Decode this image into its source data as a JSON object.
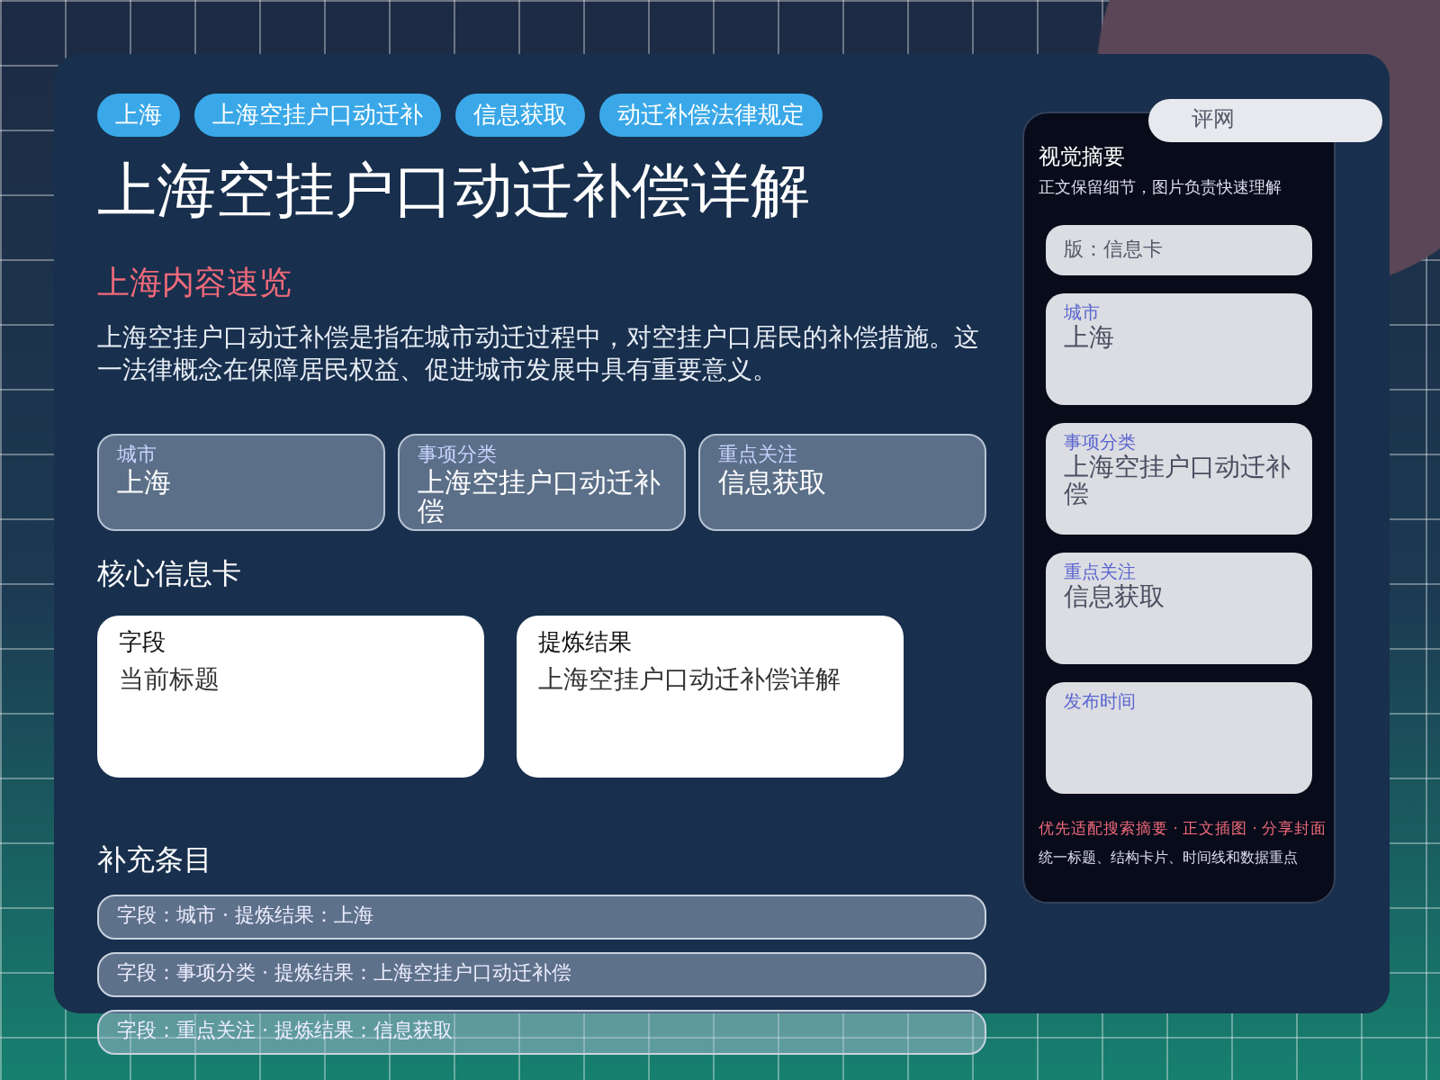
{
  "tags": [
    {
      "label": "上海"
    },
    {
      "label": "上海空挂户口动迁补"
    },
    {
      "label": "信息获取"
    },
    {
      "label": "动迁补偿法律规定"
    }
  ],
  "title": "上海空挂户口动迁补偿详解",
  "subtitle": "上海内容速览",
  "intro": "上海空挂户口动迁补偿是指在城市动迁过程中，对空挂户口居民的补偿措施。这一法律概念在保障居民权益、促进城市发展中具有重要意义。",
  "stats": [
    {
      "label": "城市",
      "value": "上海"
    },
    {
      "label": "事项分类",
      "value": "上海空挂户口动迁补偿"
    },
    {
      "label": "重点关注",
      "value": "信息获取"
    }
  ],
  "core_section": {
    "heading": "核心信息卡",
    "cards": [
      {
        "label": "字段",
        "value": "当前标题"
      },
      {
        "label": "提炼结果",
        "value": "上海空挂户口动迁补偿详解"
      }
    ]
  },
  "extra_section": {
    "heading": "补充条目",
    "rows": [
      "字段：城市 · 提炼结果：上海",
      "字段：事项分类 · 提炼结果：上海空挂户口动迁补偿",
      "字段：重点关注 · 提炼结果：信息获取"
    ]
  },
  "corner_pill": "评网",
  "sidebar": {
    "title": "视觉摘要",
    "subtitle": "正文保留细节，图片负责快速理解",
    "top_pill": "版：信息卡",
    "cards": [
      {
        "label": "城市",
        "value": "上海"
      },
      {
        "label": "事项分类",
        "value": "上海空挂户口动迁补偿"
      },
      {
        "label": "重点关注",
        "value": "信息获取"
      },
      {
        "label": "发布时间"
      }
    ],
    "note": "优先适配搜索摘要 · 正文插图 · 分享封面",
    "footer": "统一标题、结构卡片、时间线和数据重点"
  }
}
